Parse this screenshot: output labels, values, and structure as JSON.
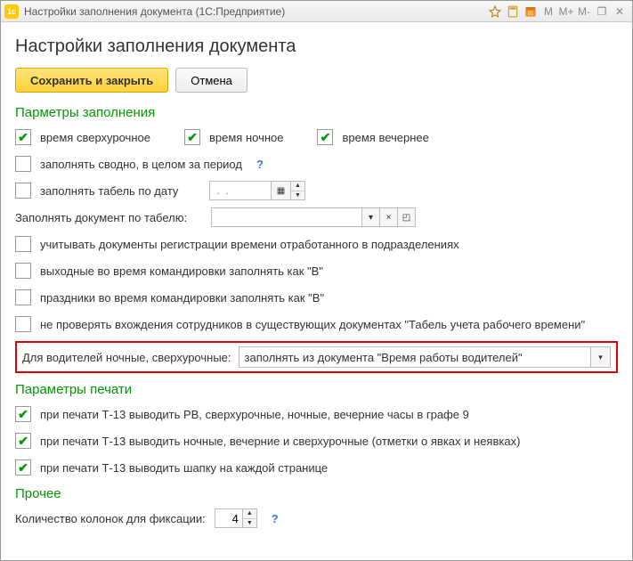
{
  "window": {
    "title": "Настройки заполнения документа  (1С:Предприятие)"
  },
  "page": {
    "title": "Настройки заполнения документа"
  },
  "buttons": {
    "save_close": "Сохранить и закрыть",
    "cancel": "Отмена"
  },
  "sections": {
    "fill_params": "Парметры заполнения",
    "print_params": "Параметры печати",
    "other": "Прочее"
  },
  "fill": {
    "overtime": "время сверхурочное",
    "night": "время ночное",
    "evening": "время вечернее",
    "summary_period": "заполнять сводно, в целом за период",
    "fill_by_date": "заполнять табель по дату",
    "date_placeholder": " .  .    ",
    "doc_by_tabel": "Заполнять документ по табелю:",
    "tabel_value": "",
    "consider_reg": "учитывать документы регистрации времени отработанного в подразделениях",
    "trip_weekends": "выходные во время командировки заполнять как \"В\"",
    "trip_holidays": "праздники во время командировки заполнять как \"В\"",
    "no_check_entries": "не проверять вхождения сотрудников в существующих документах \"Табель учета рабочего времени\""
  },
  "drivers": {
    "label": "Для водителей ночные, сверхурочные:",
    "selected": "заполнять из документа \"Время работы водителей\""
  },
  "print": {
    "t13_g9": "при печати Т-13 выводить РВ, сверхурочные, ночные, вечерние часы в графе 9",
    "t13_marks": "при печати Т-13 выводить ночные, вечерние и сверхурочные (отметки о явках и неявках)",
    "t13_header": "при печати Т-13 выводить шапку на каждой странице"
  },
  "other": {
    "fix_cols_label": "Количество колонок для фиксации:",
    "fix_cols_value": "4"
  }
}
